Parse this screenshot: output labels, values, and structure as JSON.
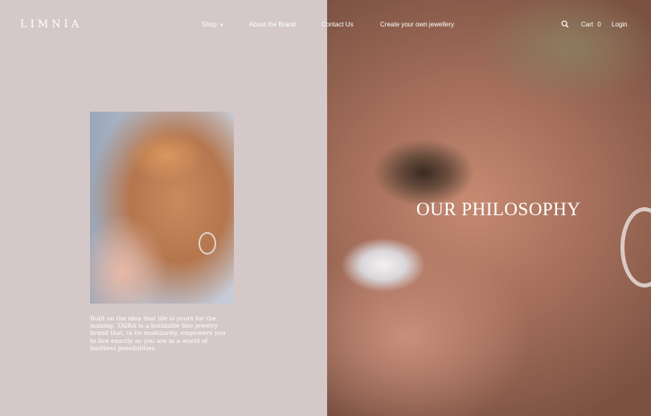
{
  "header": {
    "logo": "LIMNIA",
    "nav": {
      "shop": "Shop",
      "about": "About the Brand",
      "contact": "Contact Us",
      "create": "Create your own jewellery"
    },
    "cart_label": "Cart",
    "cart_count": "0",
    "login": "Login",
    "icons": {
      "search": "search-icon",
      "shop_dropdown": "chevron-down-icon"
    }
  },
  "left": {
    "body_text": "Built on the idea that life is yours for the making, TAIRA is a buildable fine jewelry brand that, in its modularity, empowers you to live exactly as you are in a world of limitless possibilities."
  },
  "hero": {
    "headline": "OUR PHILOSOPHY"
  },
  "colors": {
    "page_background": "#d4c9c8",
    "text": "#ffffff"
  }
}
